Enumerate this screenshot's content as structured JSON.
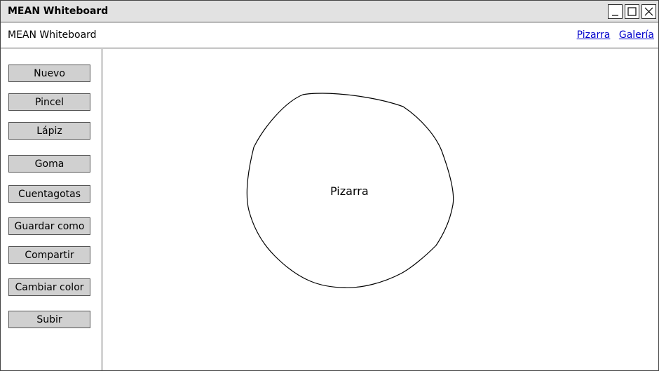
{
  "window": {
    "title": "MEAN Whiteboard"
  },
  "menubar": {
    "app_name": "MEAN Whiteboard",
    "links": [
      "Pizarra",
      "Galería"
    ]
  },
  "sidebar": {
    "buttons": [
      "Nuevo",
      "Pincel",
      "Lápiz",
      "Goma",
      "Cuentagotas",
      "Guardar como",
      "Compartir",
      "Cambiar color",
      "Subir"
    ]
  },
  "canvas": {
    "label": "Pizarra"
  }
}
